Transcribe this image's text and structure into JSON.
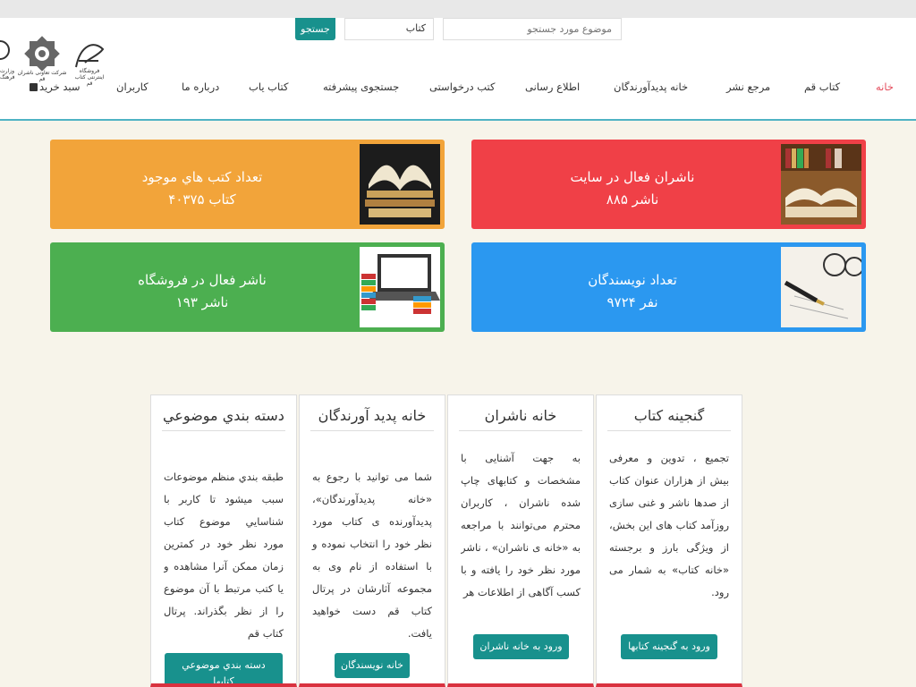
{
  "search": {
    "button_label": "جستجو",
    "select_value": "کتاب",
    "placeholder": "موضوع مورد جستجو"
  },
  "logos": {
    "left_caption": "وزارت فرهنگ",
    "middle_caption": "شرکت تعاونی ناشران قم",
    "right_caption": "فروشگاه اینترنتی کتاب قم"
  },
  "nav": {
    "items": [
      "خانه",
      "کتاب قم",
      "مرجع نشر",
      "خانه پدیدآورندگان",
      "اطلاع رسانی",
      "کتب درخواستی",
      "جستجوی پیشرفته",
      "کتاب یاب",
      "درباره ما",
      "کاربران",
      "سبد خرید"
    ],
    "active_index": 0
  },
  "stats": [
    {
      "title": "ناشران فعال در سایت",
      "value": "۸۸۵ ناشر",
      "color": "#f04047",
      "icon": "books-icon"
    },
    {
      "title": "تعداد كتب هاي موجود",
      "value": "۴۰۳۷۵ كتاب",
      "color": "#f2a43a",
      "icon": "open-book-icon"
    },
    {
      "title": "تعداد نویسندگان",
      "value": "۹۷۲۴ نفر",
      "color": "#2b98f0",
      "icon": "pen-icon"
    },
    {
      "title": "ناشر فعال در فروشگاه",
      "value": "۱۹۳ ناشر",
      "color": "#4caf50",
      "icon": "laptop-books-icon"
    }
  ],
  "columns": [
    {
      "title": "گنجینه کتاب",
      "body": "تجمیع ، تدوین و معرفی بیش از هزاران عنوان کتاب از صدها ناشر و غنی سازی روزآمد کتاب های این بخش، از ویژگی بارز و برجسته «خانه کتاب» به شمار می رود.",
      "button": "ورود به گنجینه کتابها"
    },
    {
      "title": "خانه ناشران",
      "body": "به جهت آشنایی با مشخصات و کتابهای چاپ شده ناشران ، کاربران محترم می‌توانند با مراجعه به «خانه ی ناشران» ، ناشر مورد نظر خود را یافته و با کسب آگاهی از اطلاعات هر",
      "button": "ورود به خانه ناشران"
    },
    {
      "title": "خانه پدید آورندگان",
      "body": "شما می توانید با رجوع به «خانه پدیدآورندگان»، پدیدآورنده ی کتاب مورد نظر خود را انتخاب نموده و با استفاده از نام وی به مجموعه آثارشان در پرتال کتاب قم دست خواهید یافت.",
      "button": "خانه نویسندگان"
    },
    {
      "title": "دسته بندي موضوعي",
      "body": "طبقه بندي منظم موضوعات سبب ميشود تا كاربر با شناسايي موضوع كتاب مورد نظر خود در كمترين زمان ممكن آنرا مشاهده و يا كتب مرتبط با آن موضوع را از نظر بگذراند. پرتال كتاب قم",
      "button": "دسته بندي موضوعي كتابها"
    }
  ]
}
